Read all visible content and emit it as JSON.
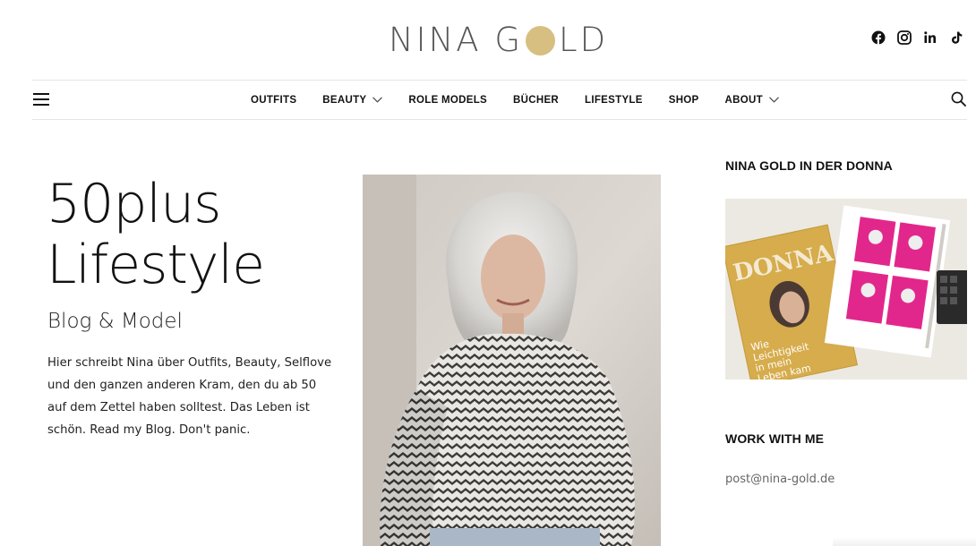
{
  "header": {
    "logo_left": "NINA G",
    "logo_right": "LD",
    "logo_accent": "#d6bf80",
    "social": [
      {
        "icon": "facebook-icon"
      },
      {
        "icon": "instagram-icon"
      },
      {
        "icon": "linkedin-icon"
      },
      {
        "icon": "tiktok-icon"
      }
    ]
  },
  "nav": {
    "items": [
      {
        "label": "OUTFITS"
      },
      {
        "label": "BEAUTY",
        "dropdown": true
      },
      {
        "label": "ROLE MODELS"
      },
      {
        "label": "BÜCHER"
      },
      {
        "label": "LIFESTYLE"
      },
      {
        "label": "SHOP"
      },
      {
        "label": "ABOUT",
        "dropdown": true
      }
    ]
  },
  "hero": {
    "title_line1": "50plus",
    "title_line2": "Lifestyle",
    "subtitle": "Blog & Model",
    "text": "Hier schreibt Nina über Outfits, Beauty, Selflove und den ganzen anderen Kram, den du ab 50 auf dem Zettel haben solltest. Das Leben ist schön. Read my Blog. Don't panic."
  },
  "sidebar": {
    "donna_title": "NINA GOLD IN DER DONNA",
    "magazine_name": "DONNA",
    "magazine_cover_line1": "Wie",
    "magazine_cover_line2": "Leichtigkeit",
    "magazine_cover_line3": "in mein",
    "magazine_cover_line4": "Leben kam",
    "work_title": "WORK WITH ME",
    "email": "post@nina-gold.de"
  }
}
